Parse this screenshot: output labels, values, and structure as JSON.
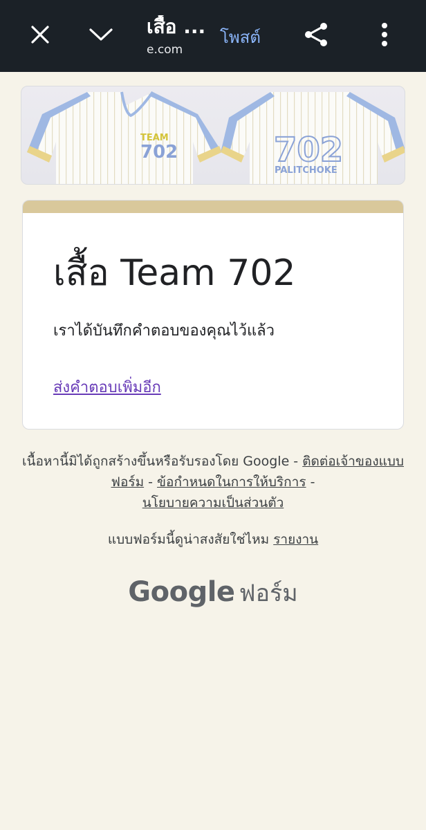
{
  "topbar": {
    "title": "เสื้อ ...",
    "domain": "e.com",
    "post_label": "โพสต์",
    "icons": [
      "close-icon",
      "chevron-down-icon",
      "share-icon",
      "more-vert-icon"
    ]
  },
  "banner": {
    "left_shirt_text_1": "TEAM",
    "left_shirt_text_2": "702",
    "right_shirt_number": "702",
    "right_shirt_name": "PALITCHOKE"
  },
  "card": {
    "title": "เสื้อ Team 702",
    "confirmation": "เราได้บันทึกคำตอบของคุณไว้แล้ว",
    "submit_another": "ส่งคำตอบเพิ่มอีก",
    "accent_color": "#d9c89b"
  },
  "footer": {
    "disclaimer": "เนื้อหานี้มิได้ถูกสร้างขึ้นหรือรับรองโดย Google - ",
    "contact_owner": "ติดต่อเจ้าของแบบฟอร์ม",
    "terms": "ข้อกำหนดในการให้บริการ",
    "privacy": "นโยบายความเป็นส่วนตัว",
    "suspicious": "แบบฟอร์มนี้ดูน่าสงสัยใช่ไหม",
    "report": "รายงาน",
    "brand_google": "Google",
    "brand_forms": "ฟอร์ม"
  }
}
